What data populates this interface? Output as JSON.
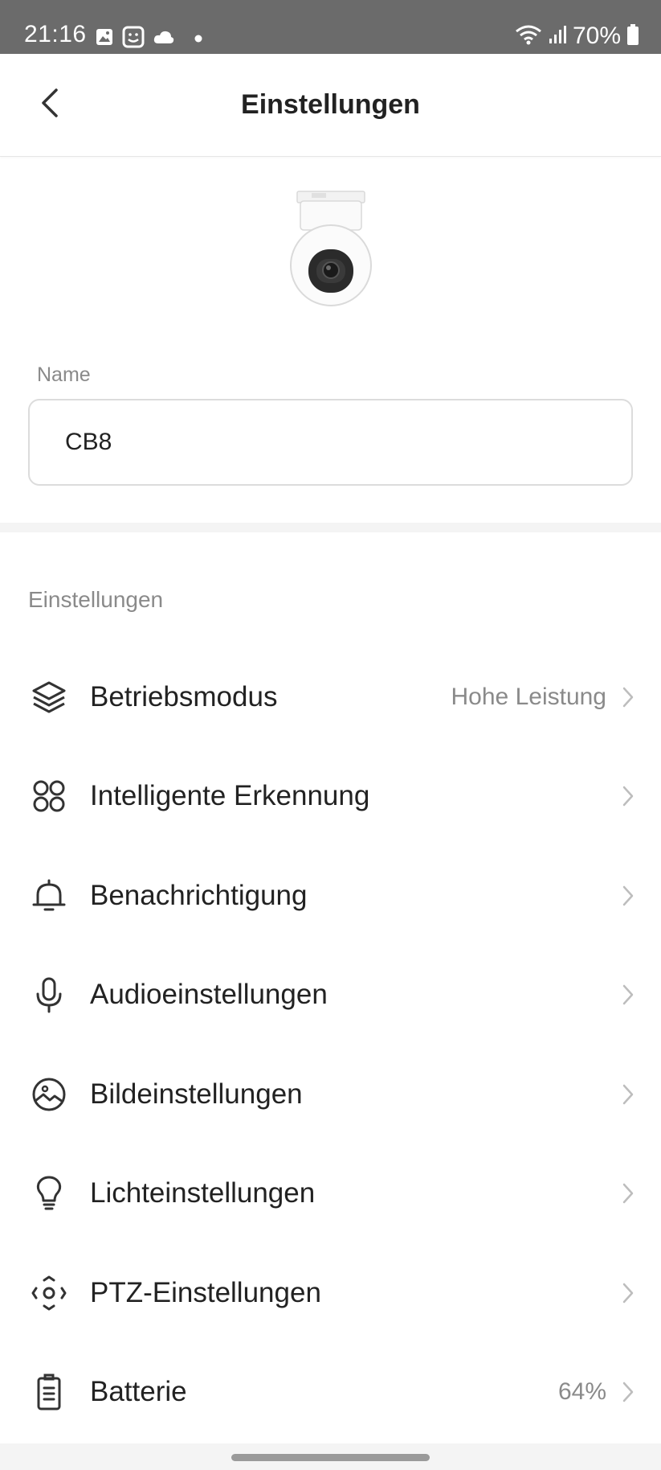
{
  "status_bar": {
    "time": "21:16",
    "battery": "70%",
    "left_icons": [
      "image-icon",
      "face-icon",
      "cloud-icon",
      "dot-icon"
    ],
    "right_icons": [
      "wifi-icon",
      "signal-icon",
      "battery-icon"
    ]
  },
  "header": {
    "title": "Einstellungen",
    "back_icon": "chevron-left-icon"
  },
  "device": {
    "image": "security-camera-image",
    "name_label": "Name",
    "name_value": "CB8"
  },
  "settings": {
    "section_title": "Einstellungen",
    "items": [
      {
        "icon": "layers-icon",
        "label": "Betriebsmodus",
        "value": "Hohe Leistung"
      },
      {
        "icon": "four-circles-icon",
        "label": "Intelligente Erkennung",
        "value": ""
      },
      {
        "icon": "bell-icon",
        "label": "Benachrichtigung",
        "value": ""
      },
      {
        "icon": "microphone-icon",
        "label": "Audioeinstellungen",
        "value": ""
      },
      {
        "icon": "image-circle-icon",
        "label": "Bildeinstellungen",
        "value": ""
      },
      {
        "icon": "lightbulb-icon",
        "label": "Lichteinstellungen",
        "value": ""
      },
      {
        "icon": "ptz-icon",
        "label": "PTZ-Einstellungen",
        "value": ""
      },
      {
        "icon": "battery-list-icon",
        "label": "Batterie",
        "value": "64%"
      }
    ]
  },
  "colors": {
    "status_bar_bg": "#6b6b6b",
    "text_primary": "#222222",
    "text_secondary": "#8a8a8a",
    "divider": "#f4f4f4",
    "border": "#dcdcdc"
  }
}
